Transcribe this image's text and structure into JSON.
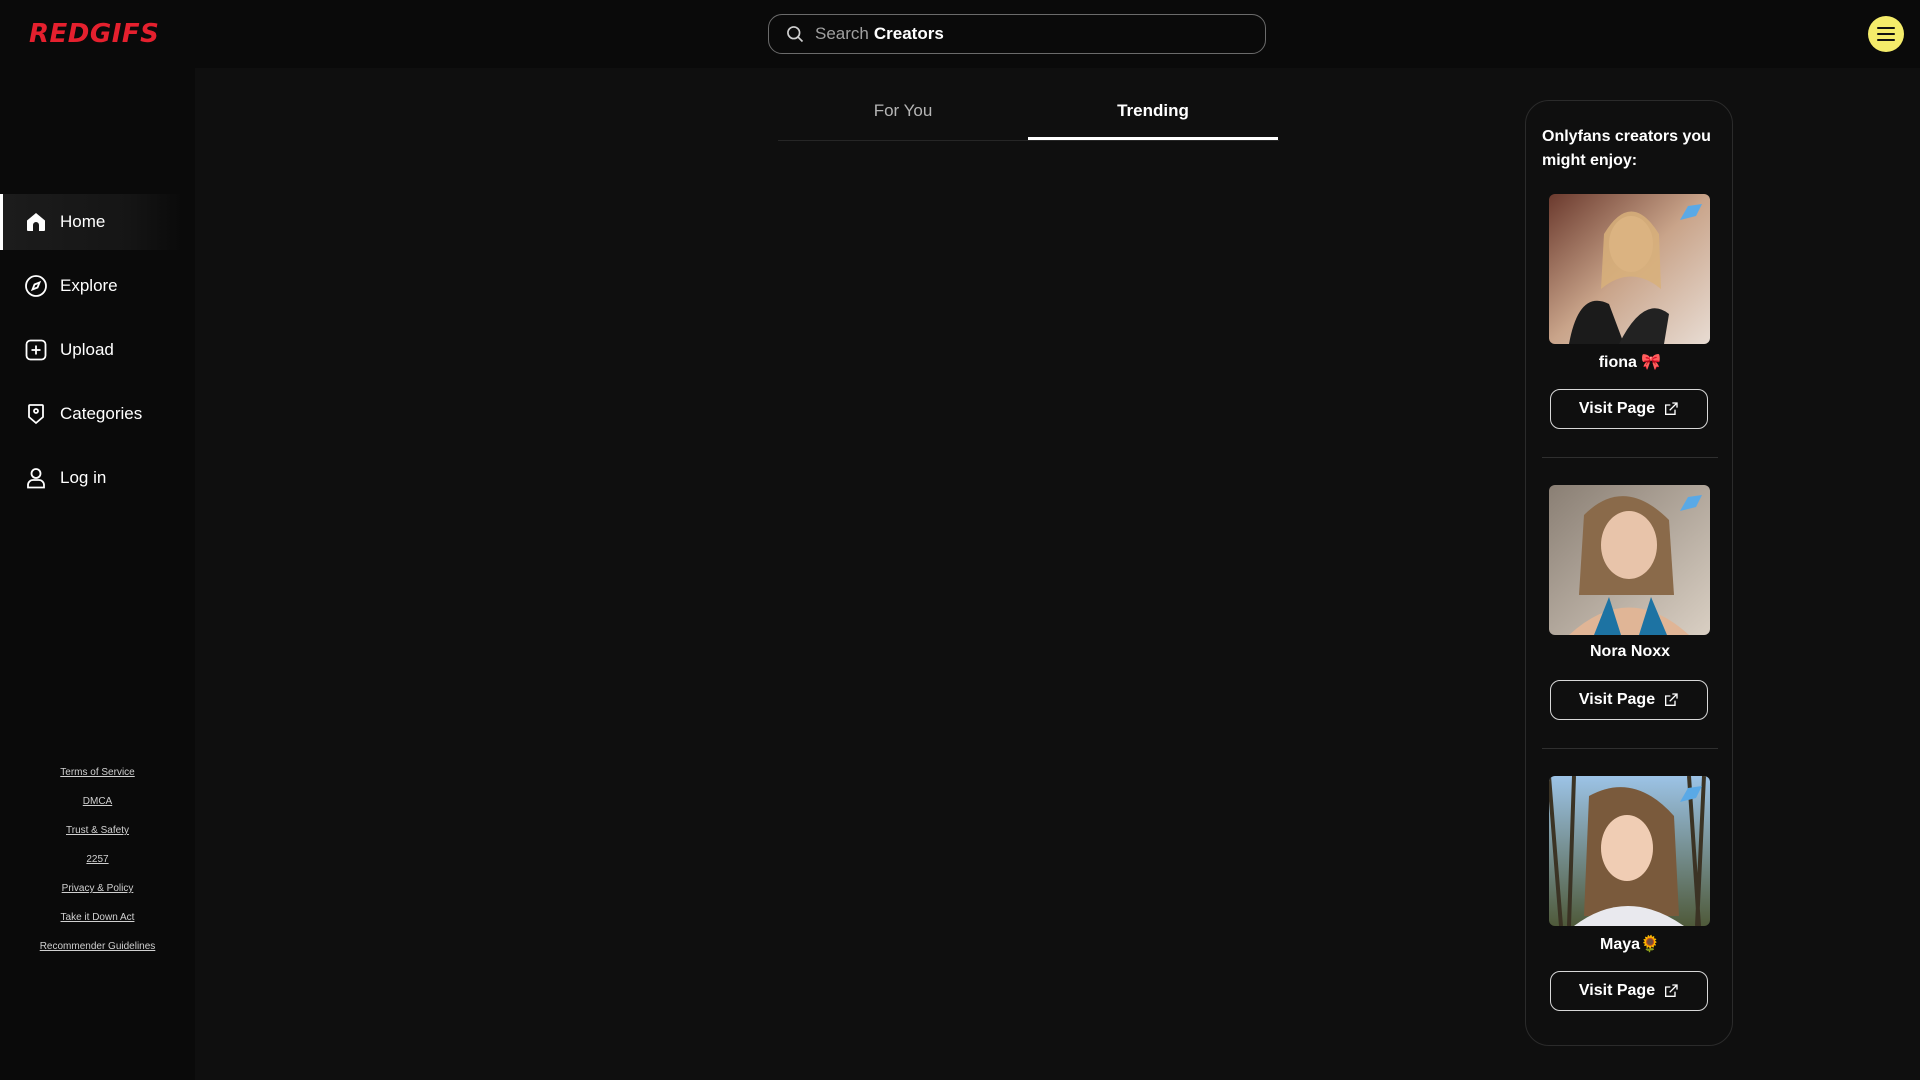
{
  "brand": {
    "logo_text": "REDGIFS",
    "accent": "#e5202e"
  },
  "search": {
    "placeholder_prefix": "Search",
    "placeholder_strong": "Creators"
  },
  "menu": {
    "icon": "hamburger-icon",
    "bg": "#f4ec6a"
  },
  "sidebar": {
    "items": [
      {
        "label": "Home",
        "icon": "home-icon",
        "active": true
      },
      {
        "label": "Explore",
        "icon": "compass-icon",
        "active": false
      },
      {
        "label": "Upload",
        "icon": "plus-square-icon",
        "active": false
      },
      {
        "label": "Categories",
        "icon": "tag-icon",
        "active": false
      },
      {
        "label": "Log in",
        "icon": "user-icon",
        "active": false
      }
    ],
    "footer_links": [
      "Terms of Service",
      "DMCA",
      "Trust & Safety",
      "2257",
      "Privacy & Policy",
      "Take it Down Act",
      "Recommender Guidelines"
    ]
  },
  "tabs": [
    {
      "label": "For You",
      "active": false
    },
    {
      "label": "Trending",
      "active": true
    }
  ],
  "recommendations": {
    "title": "Onlyfans creators you might enjoy:",
    "creators": [
      {
        "name": "fiona 🎀",
        "button": "Visit Page"
      },
      {
        "name": "Nora Noxx",
        "button": "Visit Page"
      },
      {
        "name": "Maya🌻",
        "button": "Visit Page"
      }
    ]
  }
}
